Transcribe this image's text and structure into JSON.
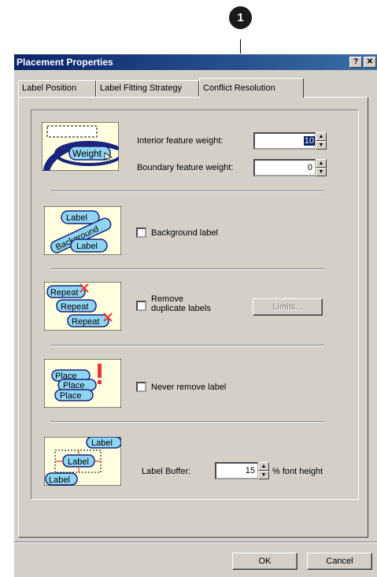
{
  "callout": {
    "number": "1"
  },
  "window": {
    "title": "Placement Properties",
    "help_btn": "?",
    "close_btn": "✕"
  },
  "tabs": [
    {
      "label": "Label Position"
    },
    {
      "label": "Label Fitting Strategy"
    },
    {
      "label": "Conflict Resolution",
      "active": true
    }
  ],
  "weights": {
    "interior_label": "Interior feature weight:",
    "interior_value": "10",
    "boundary_label": "Boundary feature weight:",
    "boundary_value": "0",
    "thumb_text": "Weight"
  },
  "background": {
    "checkbox_label": "Background label",
    "checked": false,
    "thumb_texts": [
      "Label",
      "Background",
      "Label"
    ]
  },
  "duplicates": {
    "checkbox_label_line1": "Remove",
    "checkbox_label_line2": "duplicate labels",
    "checked": false,
    "limits_button": "Limits...",
    "thumb_texts": [
      "Repeat",
      "Repeat",
      "Repeat"
    ]
  },
  "never_remove": {
    "checkbox_label": "Never remove label",
    "checked": false,
    "thumb_texts": [
      "Place",
      "Place",
      "Place"
    ]
  },
  "buffer": {
    "label": "Label Buffer:",
    "value": "15",
    "suffix": "% font height",
    "thumb_texts": [
      "Label",
      "Label",
      "Label"
    ]
  },
  "footer": {
    "ok": "OK",
    "cancel": "Cancel"
  }
}
